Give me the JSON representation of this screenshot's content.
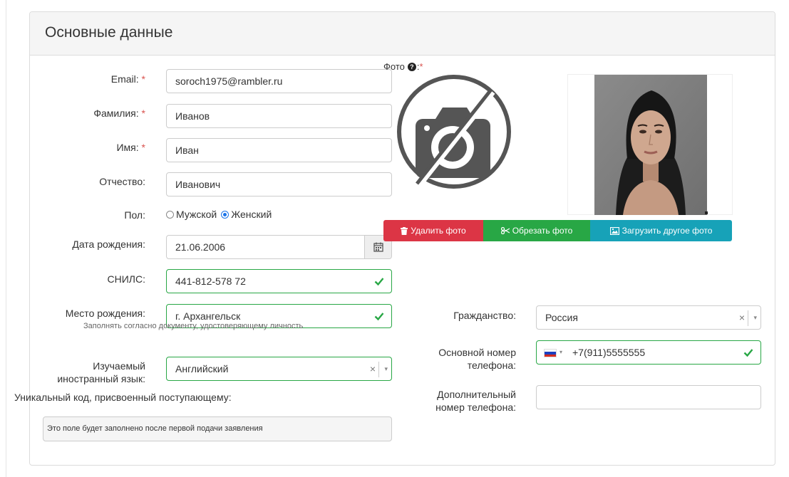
{
  "panel": {
    "title": "Основные данные"
  },
  "form": {
    "email": {
      "label": "Email:",
      "required": "*",
      "value": "soroch1975@rambler.ru"
    },
    "lastname": {
      "label": "Фамилия:",
      "required": "*",
      "value": "Иванов"
    },
    "firstname": {
      "label": "Имя:",
      "required": "*",
      "value": "Иван"
    },
    "middlename": {
      "label": "Отчество:",
      "value": "Иванович"
    },
    "gender": {
      "label": "Пол:",
      "options": [
        "Мужской",
        "Женский"
      ],
      "selected": "Женский"
    },
    "birthdate": {
      "label": "Дата рождения:",
      "value": "21.06.2006"
    },
    "snils": {
      "label": "СНИЛС:",
      "value": "441-812-578 72"
    },
    "birthplace": {
      "label": "Место рождения:",
      "value": "г. Архангельск",
      "hint": "Заполнять согласно документу, удостоверяющему личность"
    },
    "language": {
      "label_line1": "Изучаемый",
      "label_line2": "иностранный язык:",
      "value": "Английский",
      "clear": "×",
      "arrow": "▾"
    },
    "unique_code": {
      "label": "Уникальный код, присвоенный поступающему:",
      "value": "Это поле будет заполнено после первой подачи заявления"
    },
    "photo": {
      "label": "Фото",
      "help_icon": "?",
      "suffix": ":",
      "required": "*"
    },
    "citizenship": {
      "label": "Гражданство:",
      "value": "Россия",
      "clear": "×",
      "arrow": "▾"
    },
    "main_phone": {
      "label_line1": "Основной номер",
      "label_line2": "телефона:",
      "value": "+7(911)5555555",
      "flag_arrow": "▾"
    },
    "extra_phone": {
      "label_line1": "Дополнительный",
      "label_line2": "номер телефона:",
      "value": ""
    }
  },
  "photo_buttons": {
    "delete": "Удалить фото",
    "crop": "Обрезать фото",
    "upload": "Загрузить другое фото"
  },
  "icons": {
    "photo_placeholder": "no-camera-icon",
    "calendar": "calendar-icon",
    "valid": "check-icon",
    "delete": "trash-icon",
    "crop": "scissors-icon",
    "upload": "image-icon",
    "flag": "russia-flag-icon"
  },
  "colors": {
    "danger": "#dc3545",
    "success": "#28a745",
    "info": "#17a2b8",
    "required": "#d9534f",
    "radio_accent": "#1a73e8"
  }
}
